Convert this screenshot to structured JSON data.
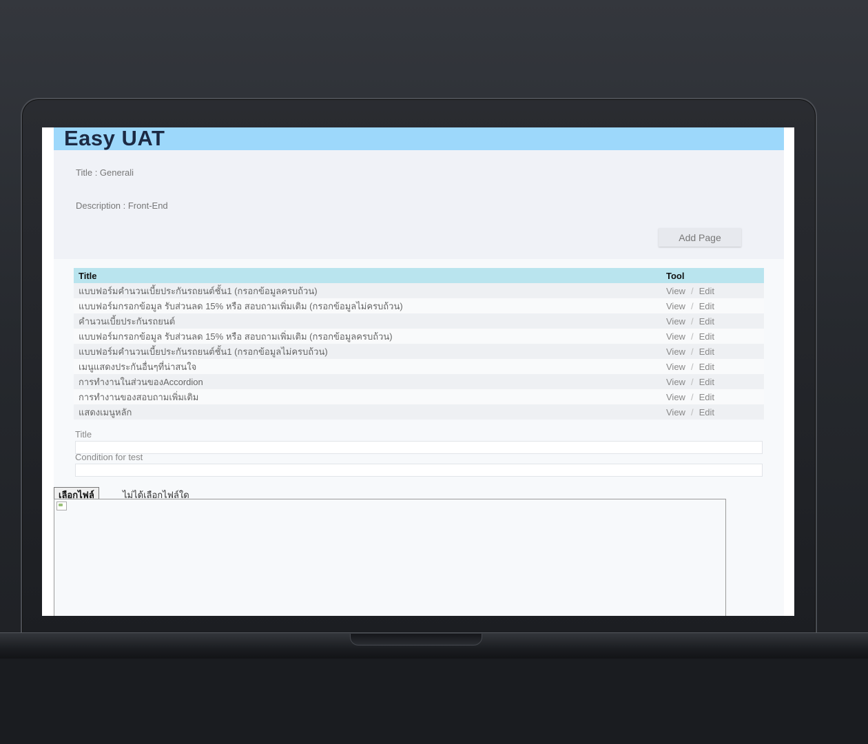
{
  "app": {
    "title": "Easy UAT"
  },
  "project": {
    "title_line": "Title : Generali",
    "description_line": "Description : Front-End",
    "add_page_label": "Add Page"
  },
  "table": {
    "headers": {
      "title": "Title",
      "tool": "Tool"
    },
    "rows": [
      {
        "title": "แบบฟอร์มคำนวนเบี้ยประกันรถยนต์ชั้น1 (กรอกข้อมูลครบถ้วน)",
        "view": "View",
        "edit": "Edit"
      },
      {
        "title": "แบบฟอร์มกรอกข้อมูล รับส่วนลด 15% หรือ สอบถามเพิ่มเติม (กรอกข้อมูลไม่ครบถ้วน)",
        "view": "View",
        "edit": "Edit"
      },
      {
        "title": "คำนวนเบี้ยประกันรถยนต์",
        "view": "View",
        "edit": "Edit"
      },
      {
        "title": "แบบฟอร์มกรอกข้อมูล รับส่วนลด 15% หรือ สอบถามเพิ่มเติม (กรอกข้อมูลครบถ้วน)",
        "view": "View",
        "edit": "Edit"
      },
      {
        "title": "แบบฟอร์มคำนวนเบี้ยประกันรถยนต์ชั้น1 (กรอกข้อมูลไม่ครบถ้วน)",
        "view": "View",
        "edit": "Edit"
      },
      {
        "title": "เมนูแสดงประกันอื่นๆที่น่าสนใจ",
        "view": "View",
        "edit": "Edit"
      },
      {
        "title": "การทำงานในส่วนของAccordion",
        "view": "View",
        "edit": "Edit"
      },
      {
        "title": "การทำงานของสอบถามเพิ่มเติม",
        "view": "View",
        "edit": "Edit"
      },
      {
        "title": "แสดงเมนูหลัก",
        "view": "View",
        "edit": "Edit"
      }
    ],
    "separator": "/"
  },
  "form": {
    "title_label": "Title",
    "title_value": "",
    "condition_label": "Condition for test",
    "condition_value": "",
    "file_button_label": "เลือกไฟล์",
    "file_status": "ไม่ได้เลือกไฟล์ใด"
  },
  "icons": {
    "preview": "broken-image-icon"
  },
  "colors": {
    "header_bg": "#9dd8fb",
    "table_header_bg": "#b9e4ee",
    "title_text": "#1c2a44"
  }
}
